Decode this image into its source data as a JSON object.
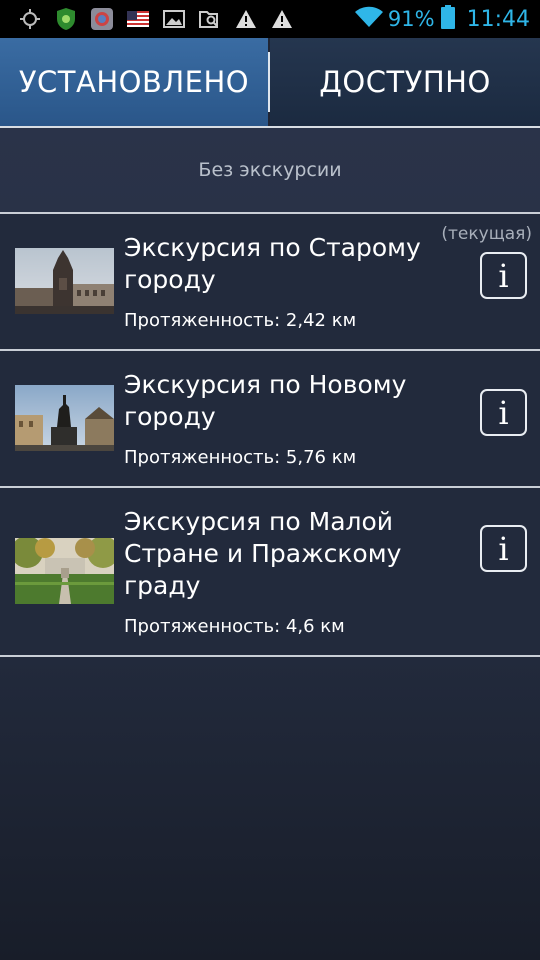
{
  "status_bar": {
    "battery": "91%",
    "time": "11:44",
    "icons": [
      "gps-icon",
      "shield-icon",
      "app-icon",
      "flag-icon",
      "gallery-icon",
      "search-file-icon",
      "warning-icon",
      "warning-icon",
      "wifi-icon",
      "battery-icon"
    ]
  },
  "tabs": {
    "installed": "УСТАНОВЛЕНО",
    "available": "ДОСТУПНО"
  },
  "no_excursion": "Без экскурсии",
  "excursions": [
    {
      "title": "Экскурсия по Старому городу",
      "length": "Протяженность: 2,42 км",
      "current_label": "(текущая)",
      "info": "i"
    },
    {
      "title": "Экскурсия по Новому городу",
      "length": "Протяженность: 5,76 км",
      "info": "i"
    },
    {
      "title": "Экскурсия по Малой Стране и Пражскому граду",
      "length": "Протяженность: 4,6 км",
      "info": "i"
    }
  ],
  "colors": {
    "accent": "#2fb6e8",
    "tab_active": "#3a6ca3",
    "background": "#222a3c"
  }
}
